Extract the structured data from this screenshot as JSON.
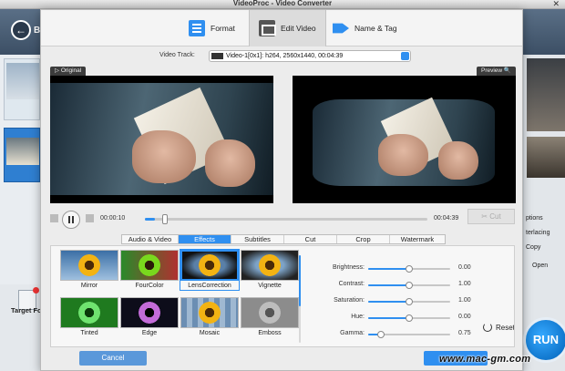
{
  "window": {
    "title": "VideoProc - Video Converter"
  },
  "background": {
    "back_label": "B",
    "target_label": "Target For",
    "options": [
      "ptions",
      "terlacing",
      "Copy"
    ],
    "open_label": "Open",
    "run_label": "RUN"
  },
  "tabs": [
    {
      "label": "Format",
      "icon": "format-icon"
    },
    {
      "label": "Edit Video",
      "icon": "edit-video-icon",
      "active": true
    },
    {
      "label": "Name & Tag",
      "icon": "name-tag-icon"
    }
  ],
  "video_track": {
    "label": "Video Track:",
    "value": "Video-1[0x1]: h264, 2560x1440, 00:04:39"
  },
  "panes": {
    "original_label": "Original",
    "preview_label": "Preview"
  },
  "playback": {
    "current_time": "00:00:10",
    "end_time": "00:04:39",
    "progress": 0.036,
    "cut_label": "Cut"
  },
  "subtabs": [
    {
      "label": "Audio & Video"
    },
    {
      "label": "Effects",
      "active": true
    },
    {
      "label": "Subtitles"
    },
    {
      "label": "Cut"
    },
    {
      "label": "Crop"
    },
    {
      "label": "Watermark"
    }
  ],
  "effects": [
    {
      "name": "Mirror"
    },
    {
      "name": "FourColor"
    },
    {
      "name": "LensCorrection",
      "selected": true
    },
    {
      "name": "Vignette"
    },
    {
      "name": "Tinted"
    },
    {
      "name": "Edge"
    },
    {
      "name": "Mosaic"
    },
    {
      "name": "Emboss"
    }
  ],
  "adjustments": [
    {
      "label": "Brightness:",
      "value": "0.00",
      "level": 0.5
    },
    {
      "label": "Contrast:",
      "value": "1.00",
      "level": 0.5
    },
    {
      "label": "Saturation:",
      "value": "1.00",
      "level": 0.5
    },
    {
      "label": "Hue:",
      "value": "0.00",
      "level": 0.5
    },
    {
      "label": "Gamma:",
      "value": "0.75",
      "level": 0.15
    }
  ],
  "reset_label": "Reset",
  "footer": {
    "cancel_label": "Cancel"
  },
  "watermark_text": "www.mac-gm.com"
}
